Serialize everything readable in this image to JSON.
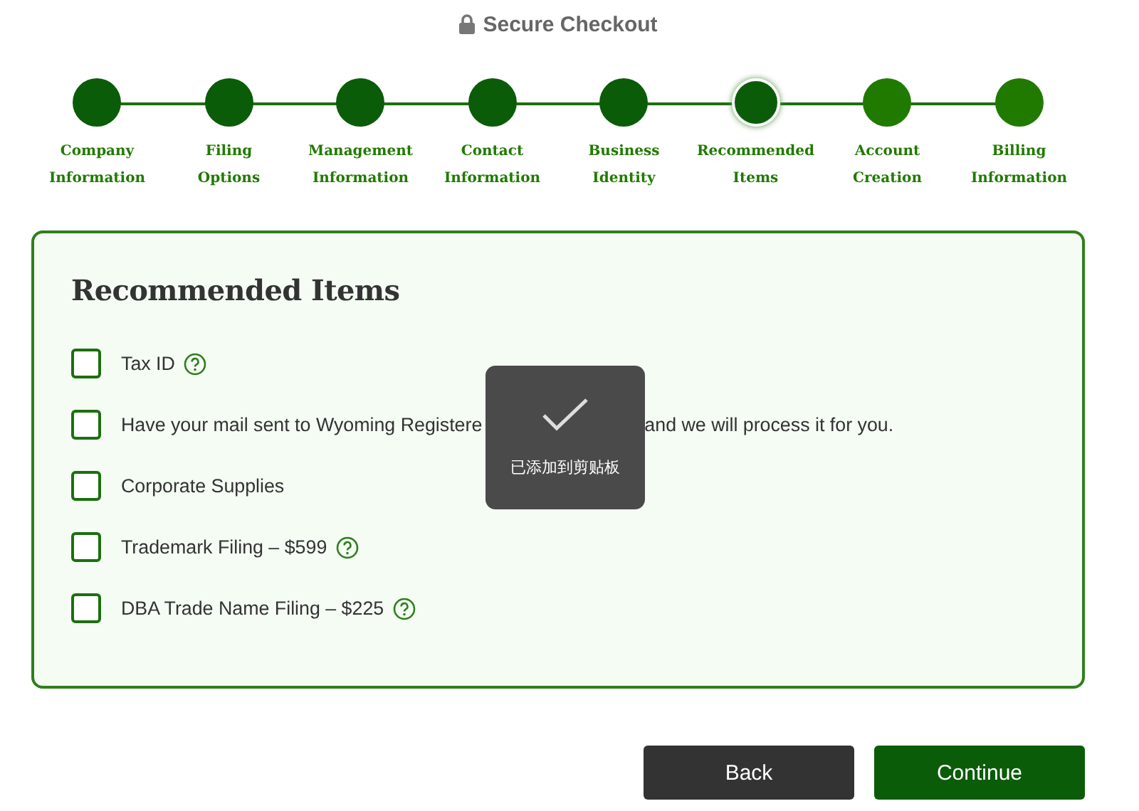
{
  "header": {
    "title": "Secure Checkout"
  },
  "steps": [
    {
      "line1": "Company",
      "line2": "Information",
      "completed": true,
      "selected": false
    },
    {
      "line1": "Filing",
      "line2": "Options",
      "completed": true,
      "selected": false
    },
    {
      "line1": "Management",
      "line2": "Information",
      "completed": true,
      "selected": false
    },
    {
      "line1": "Contact",
      "line2": "Information",
      "completed": true,
      "selected": false
    },
    {
      "line1": "Business",
      "line2": "Identity",
      "completed": true,
      "selected": false
    },
    {
      "line1": "Recommended",
      "line2": "Items",
      "completed": false,
      "selected": true
    },
    {
      "line1": "Account",
      "line2": "Creation",
      "completed": false,
      "selected": false
    },
    {
      "line1": "Billing",
      "line2": "Information",
      "completed": false,
      "selected": false
    }
  ],
  "card": {
    "title": "Recommended Items",
    "items": [
      {
        "label": "Tax ID",
        "checked": false,
        "help": true
      },
      {
        "label": "Have your mail sent to Wyoming Registere",
        "label_end": "and we will process it for you.",
        "checked": false,
        "help": false
      },
      {
        "label": "Corporate Supplies",
        "checked": false,
        "help": false
      },
      {
        "label": "Trademark Filing – $599",
        "checked": false,
        "help": true
      },
      {
        "label": "DBA Trade Name Filing – $225",
        "checked": false,
        "help": true
      }
    ]
  },
  "toast": {
    "message": "已添加到剪贴板"
  },
  "buttons": {
    "back": "Back",
    "continue": "Continue"
  }
}
